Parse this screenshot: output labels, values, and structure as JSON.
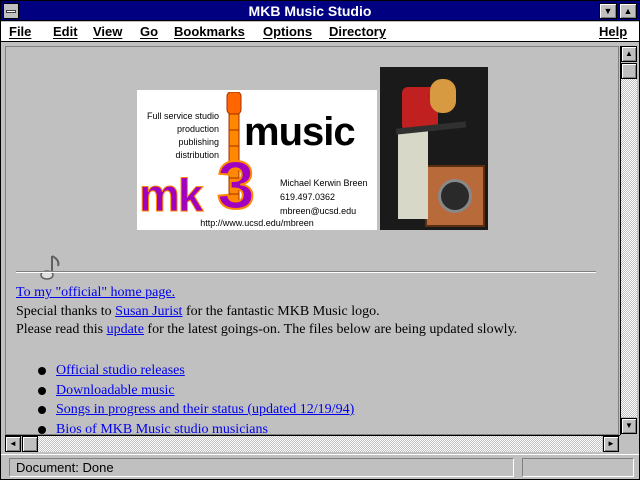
{
  "window": {
    "title": "MKB Music Studio",
    "min_glyph": "▼",
    "max_glyph": "▲"
  },
  "menu": {
    "items": [
      {
        "label": "File"
      },
      {
        "label": "Edit"
      },
      {
        "label": "View"
      },
      {
        "label": "Go"
      },
      {
        "label": "Bookmarks"
      },
      {
        "label": "Options"
      },
      {
        "label": "Directory"
      }
    ],
    "help": "Help"
  },
  "logo": {
    "services": [
      "Full service studio",
      "production",
      "publishing",
      "distribution"
    ],
    "word_music": "music",
    "mk": "mk",
    "three": "3",
    "contact": [
      "Michael Kerwin Breen",
      "619.497.0362",
      "mbreen@ucsd.edu"
    ],
    "url": "http://www.ucsd.edu/mbreen"
  },
  "content": {
    "home_link": "To my \"official\" home page.",
    "thanks_prefix": "Special thanks to ",
    "thanks_link": "Susan Jurist",
    "thanks_suffix": " for the fantastic MKB Music logo.",
    "update_prefix": "Please read this ",
    "update_link": "update",
    "update_suffix": " for the latest goings-on. The files below are being updated slowly.",
    "bullets": [
      "Official studio releases",
      "Downloadable music",
      "Songs in progress and their status (updated 12/19/94)",
      "Bios of MKB Music studio musicians"
    ]
  },
  "scroll": {
    "up": "▲",
    "down": "▼",
    "left": "◄",
    "right": "►"
  },
  "status": {
    "text": "Document: Done"
  }
}
